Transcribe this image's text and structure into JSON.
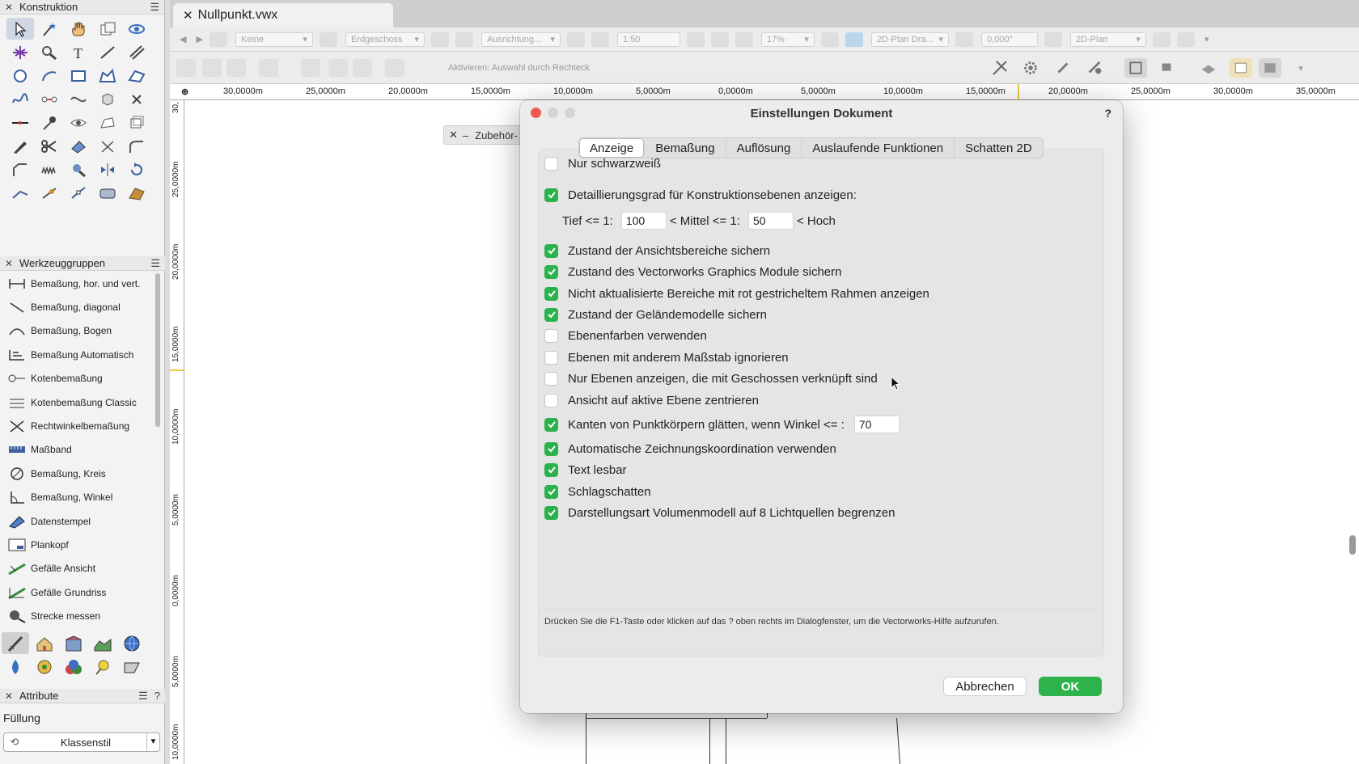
{
  "left_panel": {
    "konstruktion": {
      "title": "Konstruktion"
    },
    "werkzeuggruppen": {
      "title": "Werkzeuggruppen",
      "items": [
        {
          "label": "Bemaßung, hor. und vert.",
          "icon": "dimension-horizontal-icon"
        },
        {
          "label": "Bemaßung, diagonal",
          "icon": "dimension-diagonal-icon"
        },
        {
          "label": "Bemaßung, Bogen",
          "icon": "dimension-arc-icon"
        },
        {
          "label": "Bemaßung Automatisch",
          "icon": "dimension-auto-icon"
        },
        {
          "label": "Kotenbemaßung",
          "icon": "elevation-dimension-icon"
        },
        {
          "label": "Kotenbemaßung Classic",
          "icon": "elevation-dimension-classic-icon"
        },
        {
          "label": "Rechtwinkelbemaßung",
          "icon": "orthogonal-dimension-icon"
        },
        {
          "label": "Maßband",
          "icon": "tape-measure-icon"
        },
        {
          "label": "Bemaßung, Kreis",
          "icon": "dimension-circle-icon"
        },
        {
          "label": "Bemaßung, Winkel",
          "icon": "dimension-angle-icon"
        },
        {
          "label": "Datenstempel",
          "icon": "data-stamp-icon"
        },
        {
          "label": "Plankopf",
          "icon": "title-block-icon"
        },
        {
          "label": "Gefälle Ansicht",
          "icon": "slope-elevation-icon"
        },
        {
          "label": "Gefälle Grundriss",
          "icon": "slope-plan-icon"
        },
        {
          "label": "Strecke messen",
          "icon": "measure-distance-icon"
        }
      ]
    },
    "attribute": {
      "title": "Attribute",
      "fill_label": "Füllung",
      "fill_value": "Klassenstil"
    }
  },
  "document": {
    "tab_title": "Nullpunkt.vwx"
  },
  "toolbar1": {
    "class_select": "Keine",
    "layer_select": "Erdgeschoss",
    "align_select": "Ausrichtung...",
    "scale": "1:50",
    "zoom": "17%",
    "render_mode": "2D-Plan Dra...",
    "rotation": "0,000°",
    "view": "2D-Plan"
  },
  "toolbar2": {
    "hint": "Aktivieren: Auswahl durch Rechteck"
  },
  "ruler": {
    "h_labels": [
      "30,0000m",
      "25,0000m",
      "20,0000m",
      "15,0000m",
      "10,0000m",
      "5,0000m",
      "0,0000m",
      "5,0000m",
      "10,0000m",
      "15,0000m",
      "20,0000m",
      "25,0000m",
      "30,0000m",
      "35,0000m"
    ],
    "v_labels": [
      "30,",
      "25,0000m",
      "20,0000m",
      "15,0000m",
      "10,0000m",
      "5,0000m",
      "0,0000m",
      "5,0000m",
      "10,0000m"
    ]
  },
  "floating_palette": {
    "title": "Zubehör-"
  },
  "dialog": {
    "title": "Einstellungen Dokument",
    "help": "?",
    "tabs": [
      "Anzeige",
      "Bemaßung",
      "Auflösung",
      "Auslaufende Funktionen",
      "Schatten 2D"
    ],
    "active_tab": "Anzeige",
    "options": {
      "nur_schwarzweiss": {
        "label": "Nur schwarzweiß",
        "checked": false
      },
      "detaillierungsgrad": {
        "label": "Detaillierungsgrad für Konstruktionsebenen anzeigen:",
        "checked": true
      },
      "detail_row": {
        "tief_label": "Tief <= 1:",
        "tief_value": "100",
        "mittel_label": "< Mittel <= 1:",
        "mittel_value": "50",
        "hoch_label": "< Hoch"
      },
      "ansichtsbereiche": {
        "label": "Zustand der Ansichtsbereiche sichern",
        "checked": true
      },
      "graphics_module": {
        "label": "Zustand des Vectorworks Graphics Module sichern",
        "checked": true
      },
      "nicht_aktualisiert": {
        "label": "Nicht aktualisierte Bereiche mit rot gestricheltem Rahmen anzeigen",
        "checked": true
      },
      "gelaendemodelle": {
        "label": "Zustand der Geländemodelle sichern",
        "checked": true
      },
      "ebenenfarben": {
        "label": "Ebenenfarben verwenden",
        "checked": false
      },
      "anderer_massstab": {
        "label": "Ebenen mit anderem Maßstab ignorieren",
        "checked": false
      },
      "nur_geschosse": {
        "label": "Nur Ebenen anzeigen, die mit Geschossen verknüpft sind",
        "checked": false
      },
      "zentrieren": {
        "label": "Ansicht auf aktive Ebene zentrieren",
        "checked": false
      },
      "kanten_glaetten": {
        "label": "Kanten von Punktkörpern glätten, wenn Winkel <= :",
        "checked": true,
        "value": "70"
      },
      "zeichnungskoordination": {
        "label": "Automatische Zeichnungskoordination verwenden",
        "checked": true
      },
      "text_lesbar": {
        "label": "Text lesbar",
        "checked": true
      },
      "schlagschatten": {
        "label": "Schlagschatten",
        "checked": true
      },
      "lichtquellen": {
        "label": "Darstellungsart Volumenmodell auf 8 Lichtquellen begrenzen",
        "checked": true
      }
    },
    "hint": "Drücken Sie die F1-Taste oder klicken auf das ? oben rechts im Dialogfenster, um die Vectorworks-Hilfe aufzurufen.",
    "cancel_label": "Abbrechen",
    "ok_label": "OK"
  },
  "colors": {
    "accent_green": "#2bb24c",
    "close_red": "#ee5a52"
  }
}
